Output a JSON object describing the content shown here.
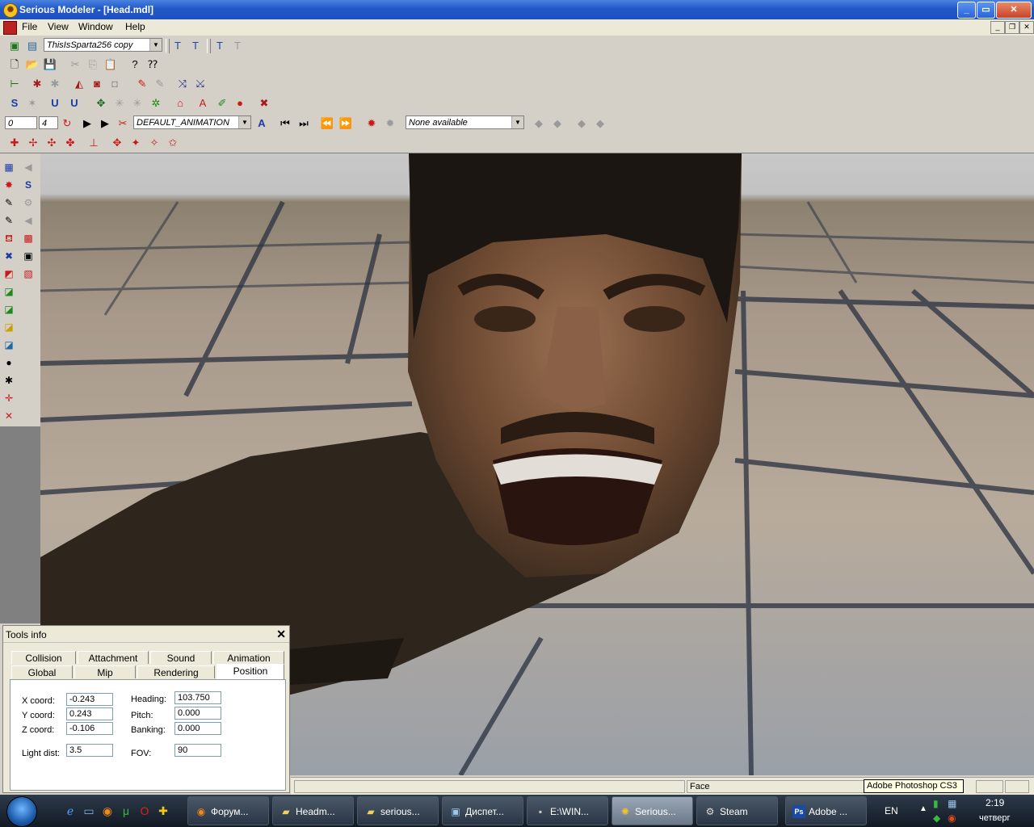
{
  "window": {
    "title": "Serious Modeler - [Head.mdl]",
    "app_icon": "serious-sam-icon",
    "controls": {
      "minimize": "_",
      "maximize": "▭",
      "close": "✕"
    }
  },
  "menubar": {
    "items": [
      "File",
      "View",
      "Window",
      "Help"
    ],
    "mdi_controls": {
      "minimize": "_",
      "restore": "❐",
      "close": "✕"
    }
  },
  "toolbars": {
    "texture_combo": "ThisIsSparta256 copy",
    "frame_start": "0",
    "frame_end": "4",
    "animation_combo": "DEFAULT_ANIMATION",
    "sound_combo": "None available",
    "combo_arrow": "▼"
  },
  "tools_info": {
    "title": "Tools info",
    "close": "✕",
    "tabs_row1": [
      "Collision",
      "Attachment",
      "Sound",
      "Animation"
    ],
    "tabs_row2": [
      "Global",
      "Mip",
      "Rendering",
      "Position"
    ],
    "active_tab": "Position",
    "fields": {
      "x_label": "X coord:",
      "x_value": "-0.243",
      "y_label": "Y coord:",
      "y_value": "0.243",
      "z_label": "Z coord:",
      "z_value": "-0.106",
      "light_label": "Light dist:",
      "light_value": "3.5",
      "heading_label": "Heading:",
      "heading_value": "103.750",
      "pitch_label": "Pitch:",
      "pitch_value": "0.000",
      "banking_label": "Banking:",
      "banking_value": "0.000",
      "fov_label": "FOV:",
      "fov_value": "90"
    }
  },
  "statusbar": {
    "field": "Face",
    "tooltip": "Adobe Photoshop CS3"
  },
  "taskbar": {
    "tasks": [
      {
        "label": "Форум...",
        "icon": "firefox-icon"
      },
      {
        "label": "Headm...",
        "icon": "folder-icon"
      },
      {
        "label": "serious...",
        "icon": "folder-icon"
      },
      {
        "label": "Диспет...",
        "icon": "task-manager-icon"
      },
      {
        "label": "E:\\WIN...",
        "icon": "cmd-icon"
      },
      {
        "label": "Serious...",
        "icon": "serious-sam-icon"
      },
      {
        "label": "Steam",
        "icon": "steam-icon"
      },
      {
        "label": "Adobe ...",
        "icon": "photoshop-icon"
      }
    ],
    "active_task": "Serious...",
    "language": "EN",
    "clock_time": "2:19",
    "clock_day": "четверг"
  },
  "colors": {
    "titlebar": "#2158c8",
    "face_panel": "#d4d0c8",
    "taskbar": "#1b2430"
  }
}
